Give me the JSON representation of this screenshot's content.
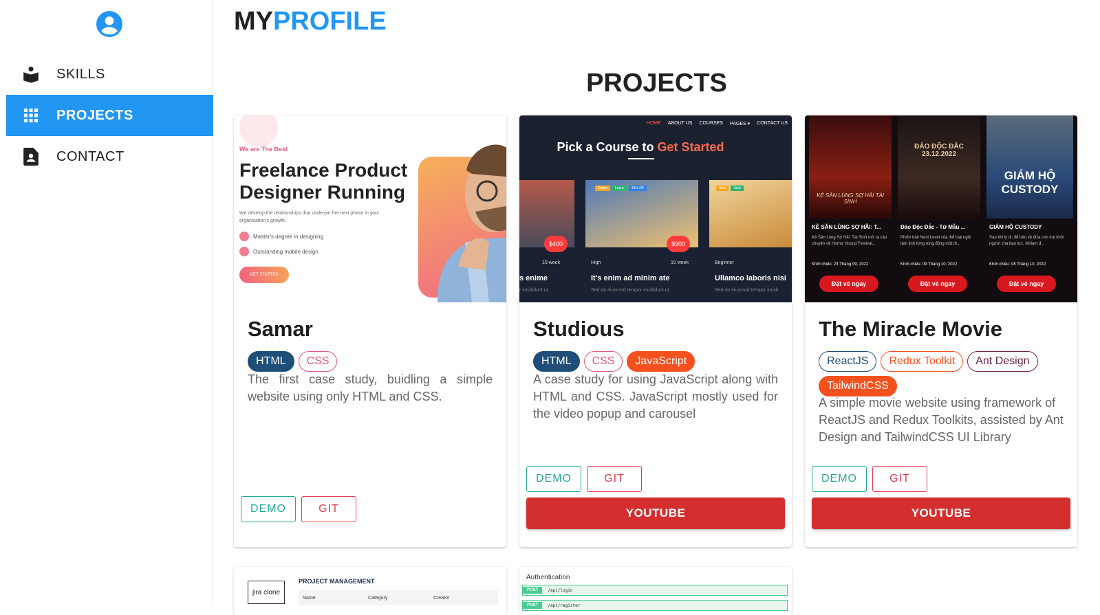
{
  "sidebar": {
    "items": [
      {
        "label": "SKILLS",
        "icon": "book-reader-icon"
      },
      {
        "label": "PROJECTS",
        "icon": "grid-icon"
      },
      {
        "label": "CONTACT",
        "icon": "contact-file-icon"
      }
    ]
  },
  "brand": {
    "part1": "MY",
    "part2": "PROFILE"
  },
  "section_title": "PROJECTS",
  "projects": [
    {
      "title": "Samar",
      "tags": [
        "HTML",
        "CSS"
      ],
      "description": "The first case study, buidling a simple website using only HTML and CSS.",
      "demo": "DEMO",
      "git": "GIT",
      "thumb": {
        "kicker": "We are The Best",
        "headline1": "Freelance Product",
        "headline2": "Designer Running",
        "sub": "We develop the relationships that underpin the next phase in your organisation's growth.",
        "check1": "Master's degree in designing",
        "check2": "Outstanding mobile design",
        "cta": "GET STARTED"
      }
    },
    {
      "title": "Studious",
      "tags": [
        "HTML",
        "CSS",
        "JavaScript"
      ],
      "description": "A case study for using JavaScript along with HTML and CSS. JavaScript mostly used for the video popup and carousel",
      "demo": "DEMO",
      "git": "GIT",
      "youtube": "YOUTUBE",
      "thumb": {
        "nav": [
          "HOME",
          "ABOUT US",
          "COURSES",
          "PAGES ▾",
          "CONTACT US"
        ],
        "heading1": "Pick a Course to",
        "heading2": "Get Started",
        "course1": {
          "price": "$400",
          "duration": "10 week",
          "title": "s enime",
          "sub": "r incididunt ut"
        },
        "course2": {
          "badges": [
            "Digital",
            "Learn",
            "10% Off"
          ],
          "price": "$900",
          "level": "High",
          "duration": "10 week",
          "title": "It's enim ad minim ate",
          "sub": "Sed do eiusmod tempor incididunt ut"
        },
        "course3": {
          "badges": [
            "Html",
            "Java"
          ],
          "level": "Beginner",
          "title": "Ullamco laboris nisi",
          "sub": "Sed do eiusmod tempor incidi"
        }
      }
    },
    {
      "title": "The Miracle Movie",
      "tags": [
        "ReactJS",
        "Redux Toolkit",
        "Ant Design",
        "TailwindCSS"
      ],
      "description": "A simple movie website using framework of ReactJS and Redux Toolkits, assisted by Ant Design and TailwindCSS UI Library",
      "demo": "DEMO",
      "git": "GIT",
      "youtube": "YOUTUBE",
      "thumb": {
        "movies": [
          {
            "poster": "KẺ SĂN LÙNG SỢ HÃI TÀI SINH",
            "name": "KẺ SĂN LÙNG SỢ HÃI: T...",
            "desc": "Kẻ Săn Lùng Sợ Hãi: Tái Sinh mở ra câu chuyện về Horror Hound Festival...",
            "date": "Khởi chiếu: 23 Tháng 09, 2022",
            "cta": "Đặt vé ngay"
          },
          {
            "poster": "ĐẢO ĐỘC ĐẮC 23.12.2022",
            "name": "Đảo Độc Đắc - Tứ Mẫu ...",
            "desc": "Phiên bản Next Level của thể loại ngồi tâm linh từng rúng động một th...",
            "date": "Khởi chiếu: 09 Tháng 10, 2022",
            "cta": "Đặt vé ngay"
          },
          {
            "poster": "GIÁM HỘ CUSTODY",
            "name": "GIÁM HỘ CUSTODY",
            "desc": "Sau khi ly dị, để bảo vệ đứa con trai khỏi người cha bạo lực, Miriam đ...",
            "date": "Khởi chiếu: 08 Tháng 10, 2022",
            "cta": "Đặt vé ngay"
          }
        ]
      }
    }
  ],
  "next_row": [
    {
      "logo": "jira clone",
      "heading": "PROJECT MANAGEMENT",
      "cols": [
        "Name",
        "Category",
        "Creator"
      ]
    },
    {
      "heading": "Authentication",
      "endpoints": [
        {
          "method": "POST",
          "path": "/api/login"
        },
        {
          "method": "POST",
          "path": "/api/register"
        }
      ]
    }
  ],
  "colors": {
    "accent": "#2196f3",
    "youtube": "#d32f2f",
    "demo": "#26a69a",
    "git": "#e53950",
    "html": "#1f4e79",
    "css": "#e05a7a",
    "js": "#f4511e"
  }
}
